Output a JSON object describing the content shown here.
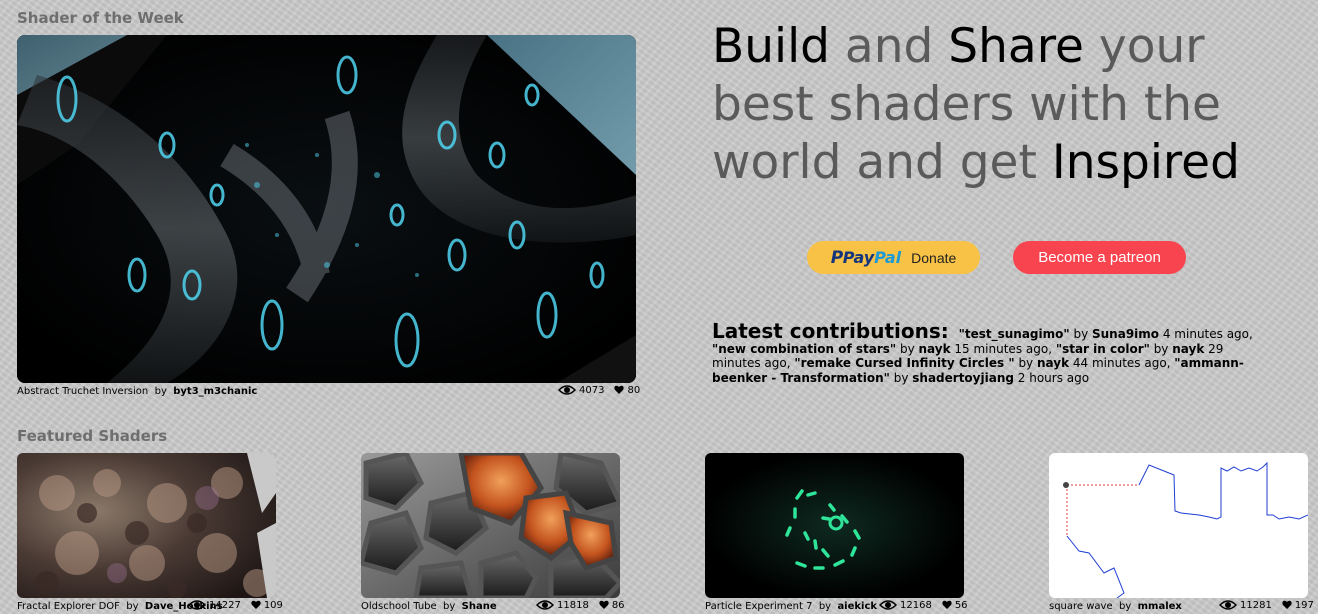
{
  "shader_of_week": {
    "section_title": "Shader of the Week",
    "name": "Abstract Truchet Inversion",
    "by": "by",
    "author": "byt3_m3chanic",
    "views": "4073",
    "likes": "80"
  },
  "headline": {
    "w1": "Build",
    "w2": " and ",
    "w3": "Share",
    "w4": " your best shaders with the world and get ",
    "w5": "Inspired"
  },
  "buttons": {
    "paypal_logo_pay": "Pay",
    "paypal_logo_pal": "Pal",
    "paypal_donate": "Donate",
    "patreon": "Become a patreon"
  },
  "latest": {
    "heading": "Latest contributions:",
    "items": [
      {
        "title": "\"test_sunagimo\"",
        "by": " by ",
        "author": "Suna9imo",
        "time": " 4 minutes ago, "
      },
      {
        "title": "\"new combination of stars\"",
        "by": " by ",
        "author": "nayk",
        "time": " 15 minutes ago, "
      },
      {
        "title": "\"star in color\"",
        "by": " by ",
        "author": "nayk",
        "time": " 29 minutes ago, "
      },
      {
        "title": "\"remake Cursed Infinity Circles \"",
        "by": " by ",
        "author": "nayk",
        "time": " 44 minutes ago, "
      },
      {
        "title": "\"ammann-beenker - Transformation\"",
        "by": " by ",
        "author": "shadertoyjiang",
        "time": " 2 hours ago"
      }
    ]
  },
  "featured": {
    "section_title": "Featured Shaders",
    "cards": [
      {
        "name": "Fractal Explorer DOF",
        "by": "by",
        "author": "Dave_Hoskins",
        "views": "14227",
        "likes": "109"
      },
      {
        "name": "Oldschool Tube",
        "by": "by",
        "author": "Shane",
        "views": "11818",
        "likes": "86"
      },
      {
        "name": "Particle Experiment 7",
        "by": "by",
        "author": "aiekick",
        "views": "12168",
        "likes": "56"
      },
      {
        "name": "square wave",
        "by": "by",
        "author": "mmalex",
        "views": "11281",
        "likes": "197"
      }
    ]
  },
  "icons": {
    "views": "eye-icon",
    "likes": "heart-icon"
  },
  "colors": {
    "paypal_yellow": "#f7c245",
    "patreon_red": "#f7444e",
    "accent_cyan": "#4fd4f0",
    "headline_gray": "#5a5a5a"
  }
}
